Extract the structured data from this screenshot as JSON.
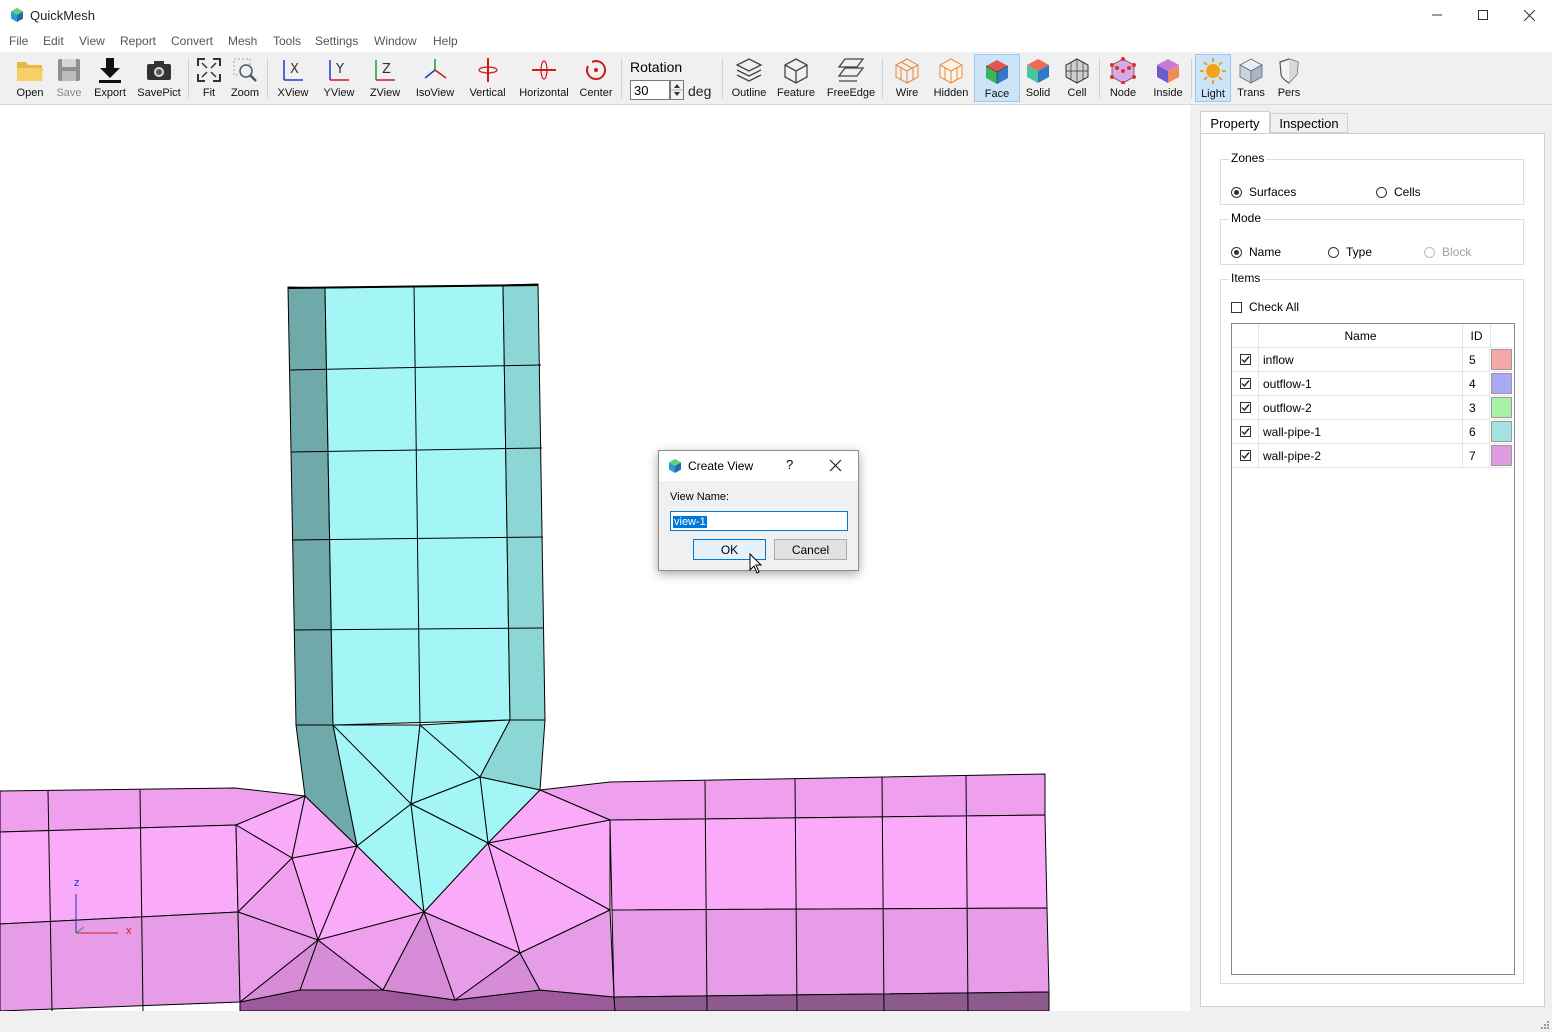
{
  "window": {
    "title": "QuickMesh",
    "minimize_icon": "minimize-icon",
    "maximize_icon": "maximize-icon",
    "close_icon": "close-icon"
  },
  "menu": [
    "File",
    "Edit",
    "View",
    "Report",
    "Convert",
    "Mesh",
    "Tools",
    "Settings",
    "Window",
    "Help"
  ],
  "toolbar": {
    "open": "Open",
    "save": "Save",
    "export": "Export",
    "savepict": "SavePict",
    "fit": "Fit",
    "zoom": "Zoom",
    "xview": "XView",
    "yview": "YView",
    "zview": "ZView",
    "isoview": "IsoView",
    "vertical": "Vertical",
    "horizontal": "Horizontal",
    "center": "Center",
    "rotation_label": "Rotation",
    "rotation_value": "30",
    "rotation_unit": "deg",
    "outline": "Outline",
    "feature": "Feature",
    "freeedge": "FreeEdge",
    "wire": "Wire",
    "hidden": "Hidden",
    "face": "Face",
    "solid": "Solid",
    "cell": "Cell",
    "node": "Node",
    "inside": "Inside",
    "light": "Light",
    "trans": "Trans",
    "pers": "Pers"
  },
  "panel": {
    "tabs": [
      "Property",
      "Inspection"
    ],
    "zones": {
      "title": "Zones",
      "options": [
        "Surfaces",
        "Cells"
      ],
      "selected": "Surfaces"
    },
    "mode": {
      "title": "Mode",
      "options": [
        "Name",
        "Type",
        "Block"
      ],
      "selected": "Name"
    },
    "items": {
      "title": "Items",
      "check_all": "Check All",
      "columns": [
        "Name",
        "ID"
      ],
      "rows": [
        {
          "name": "inflow",
          "id": "5",
          "color": "#f5a8a8"
        },
        {
          "name": "outflow-1",
          "id": "4",
          "color": "#a9a9f5"
        },
        {
          "name": "outflow-2",
          "id": "3",
          "color": "#a8f2a8"
        },
        {
          "name": "wall-pipe-1",
          "id": "6",
          "color": "#a4e2e2"
        },
        {
          "name": "wall-pipe-2",
          "id": "7",
          "color": "#e19be1"
        }
      ]
    }
  },
  "axes": {
    "z": "z",
    "x": "x"
  },
  "dialog": {
    "title": "Create View",
    "help": "?",
    "label": "View Name:",
    "value": "view-1",
    "ok": "OK",
    "cancel": "Cancel"
  },
  "colors": {
    "pipe_face": "#a4f5f5",
    "pipe_side": "#70a9a9",
    "wall_face": "#f9aaf9",
    "wall_shade": "#e69ce6",
    "accent": "#0078d7"
  }
}
